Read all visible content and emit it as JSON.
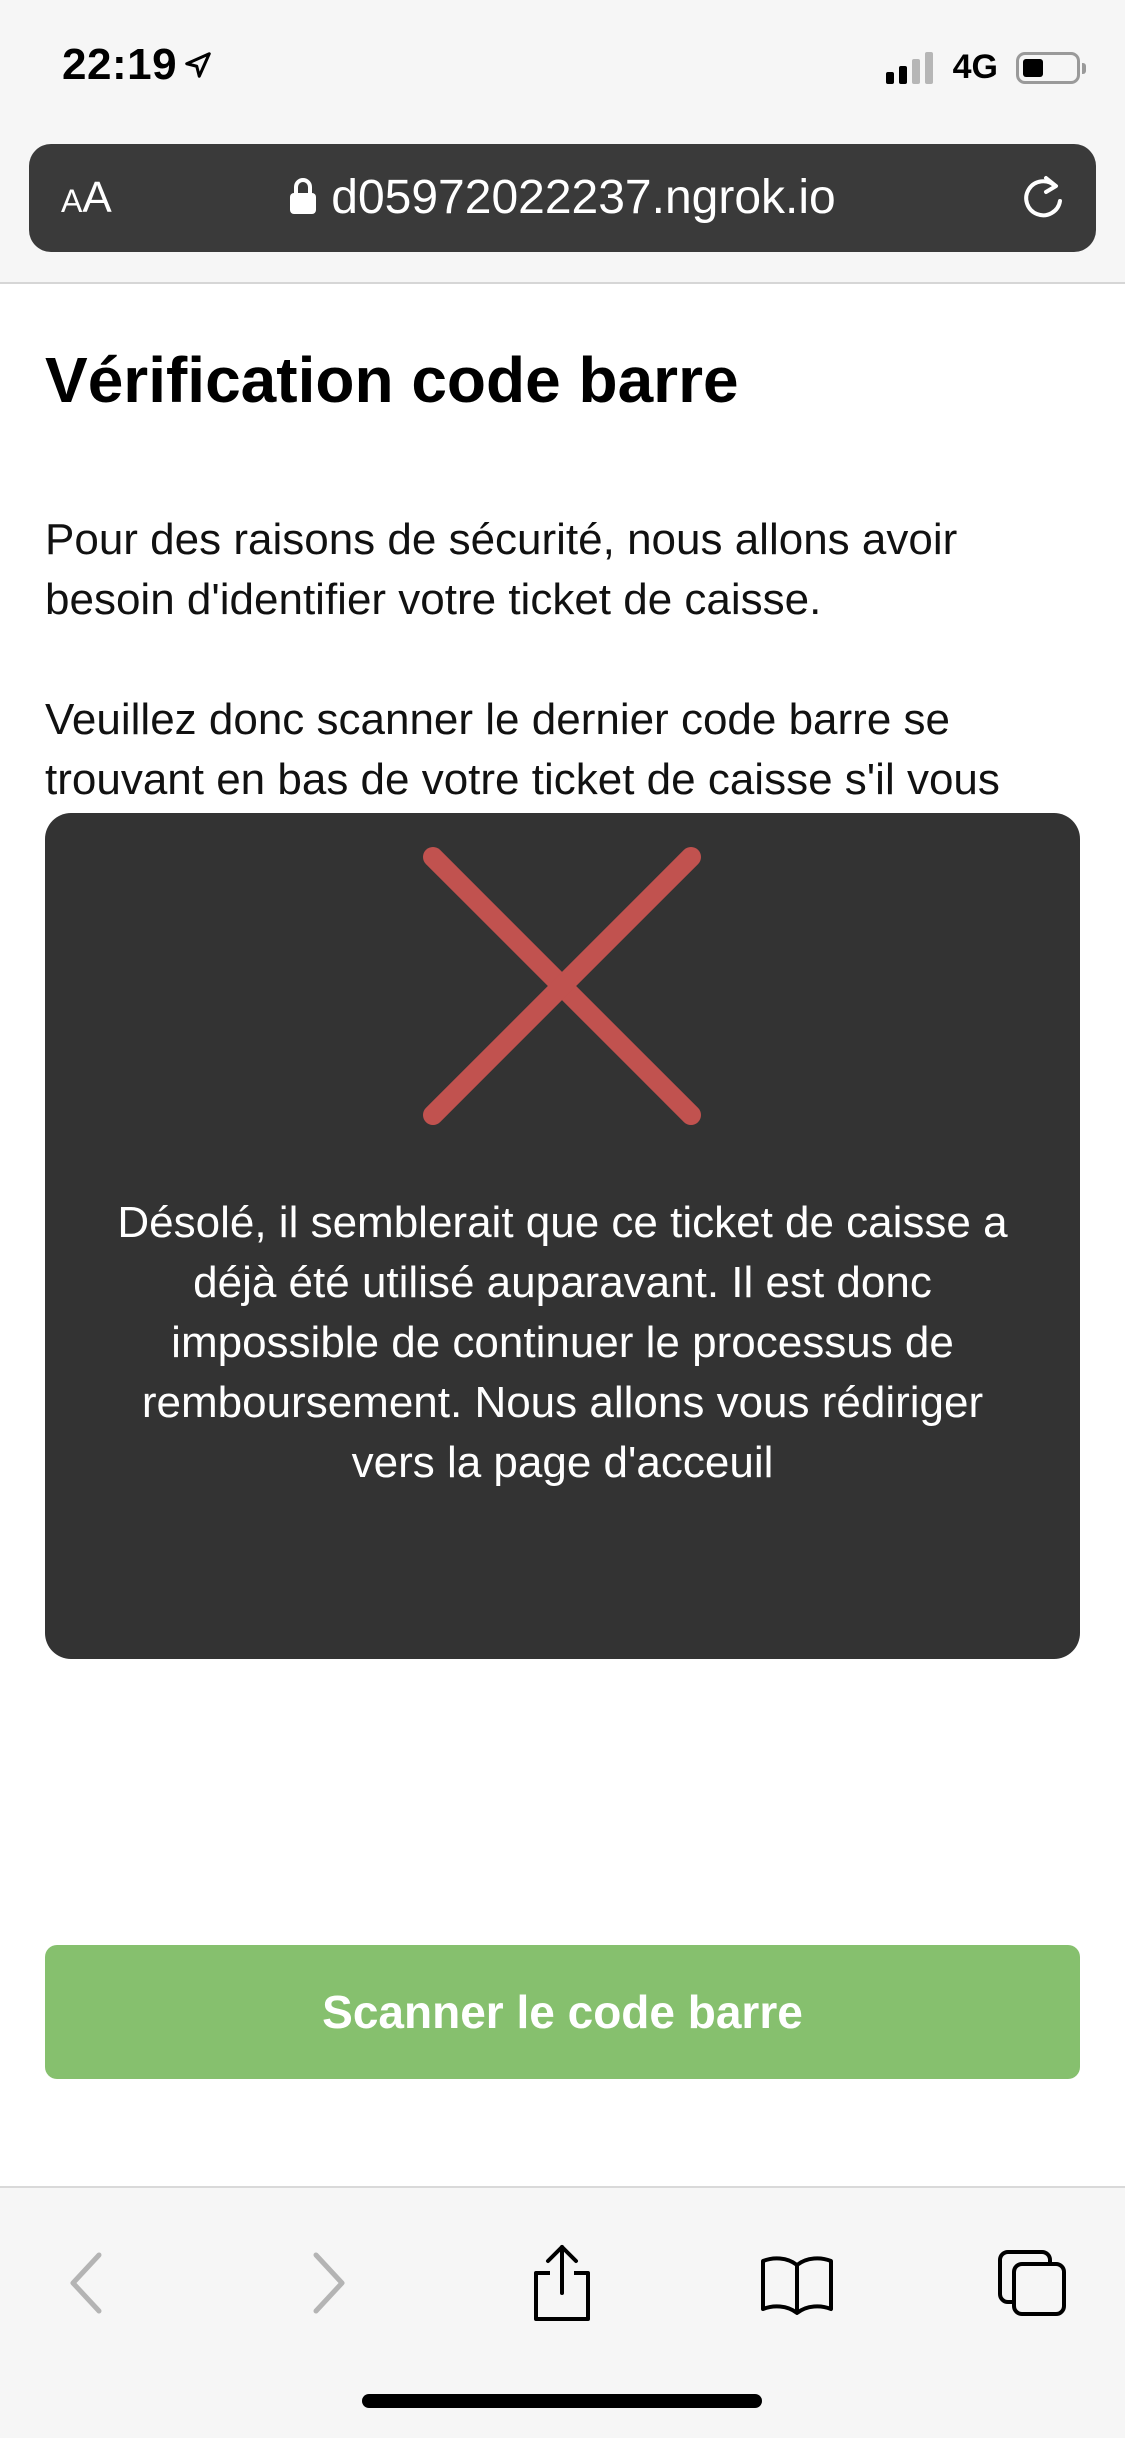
{
  "status_bar": {
    "time": "22:19",
    "network": "4G",
    "icons": [
      "location-arrow-icon",
      "signal-icon",
      "battery-icon"
    ]
  },
  "address_bar": {
    "text_size_label_small": "A",
    "text_size_label_large": "A",
    "url": "d05972022237.ngrok.io",
    "icons": [
      "lock-icon",
      "reload-icon"
    ]
  },
  "page": {
    "title": "Vérification code barre",
    "paragraph1": "Pour des raisons de sécurité, nous allons avoir besoin d'identifier votre ticket de caisse.",
    "paragraph2": "Veuillez donc scanner le dernier code barre se trouvant en bas de votre ticket de caisse s'il vous plait."
  },
  "modal": {
    "icon": "error-x-icon",
    "icon_color": "#c1524f",
    "message": "Désolé, il semblerait que ce ticket de caisse a déjà été utilisé auparavant. Il est donc impossible de continuer le processus de remboursement. Nous allons vous rédiriger vers la page d'acceuil"
  },
  "action": {
    "scan_label": "Scanner le code barre",
    "color": "#86c06e"
  },
  "toolbar": {
    "icons": [
      "back-icon",
      "forward-icon",
      "share-icon",
      "bookmarks-icon",
      "tabs-icon"
    ]
  }
}
